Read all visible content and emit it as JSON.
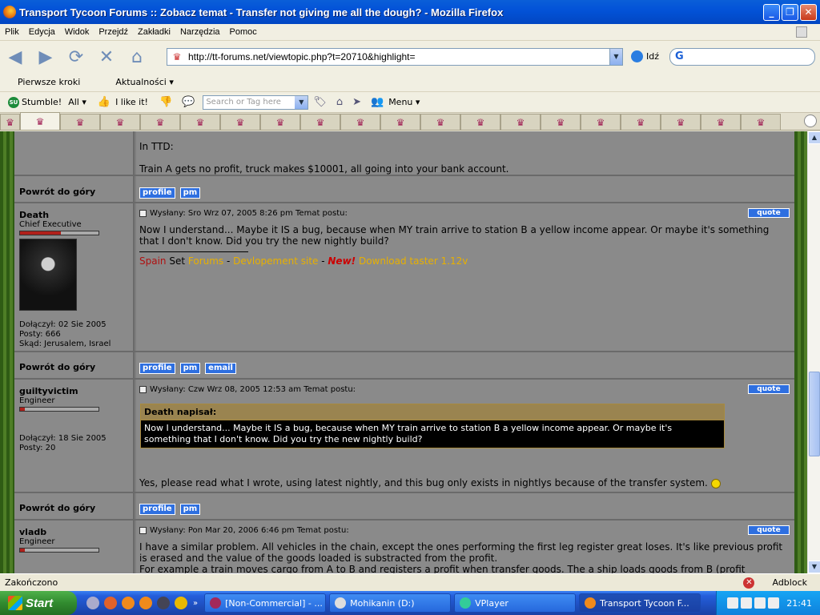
{
  "window": {
    "title": "Transport Tycoon Forums :: Zobacz temat - Transfer not giving me all the dough? - Mozilla Firefox"
  },
  "menu": [
    "Plik",
    "Edycja",
    "Widok",
    "Przejdź",
    "Zakładki",
    "Narzędzia",
    "Pomoc"
  ],
  "nav": {
    "url": "http://tt-forums.net/viewtopic.php?t=20710&highlight=",
    "go_label": "Idź"
  },
  "bookmarks": [
    "Pierwsze kroki",
    "Aktualności"
  ],
  "stumble": {
    "stumble_label": "Stumble!",
    "all_label": "All",
    "like_label": "I like it!",
    "search_placeholder": "Search or Tag here",
    "menu_label": "Menu"
  },
  "forum": {
    "back_label": "Powrót do góry",
    "profile_label": "profile",
    "pm_label": "pm",
    "email_label": "email",
    "quote_label": "quote",
    "post0": {
      "line1": "In TTD:",
      "line2": "Train A gets no profit, truck makes $10001, all going into your bank account."
    },
    "post1": {
      "user": "Death",
      "rank": "Chief Executive",
      "joined": "Dołączył: 02 Sie 2005",
      "posts": "Posty: 666",
      "from": "Skąd: Jerusalem, Israel",
      "head": "Wysłany: Sro Wrz 07, 2005 8:26 pm     Temat postu:",
      "text": "Now I understand... Maybe it IS a bug, because when MY train arrive to station B a yellow income appear. Or maybe it's something that I don't know. Did you try the new nightly build?",
      "sig": {
        "spain": "Spain",
        "set": " Set ",
        "forums": "Forums",
        "dash1": " - ",
        "dev": "Devlopement site",
        "dash2": " - ",
        "new": "New!",
        "dl": " Download taster 1.12v"
      }
    },
    "post2": {
      "user": "guiltyvictim",
      "rank": "Engineer",
      "joined": "Dołączył: 18 Sie 2005",
      "posts": "Posty: 20",
      "head": "Wysłany: Czw Wrz 08, 2005 12:53 am     Temat postu:",
      "quote_head": "Death napisał:",
      "quote_text": "Now I understand... Maybe it IS a bug, because when MY train arrive to station B a yellow income appear. Or maybe it's something that I don't know. Did you try the new nightly build?",
      "text": "Yes, please read what I wrote, using latest nightly, and this bug only exists in nightlys because of the transfer system."
    },
    "post3": {
      "user": "vladb",
      "rank": "Engineer",
      "head": "Wysłany: Pon Mar 20, 2006 6:46 pm     Temat postu:",
      "text": "I have a similar problem. All vehicles in the chain, except the ones performing the first leg register great loses. It's like previous profit is erased and the value of the goods loaded is substracted from the profit.",
      "text2": "For example a train moves cargo from A to B and registers a profit when transfer goods. The a ship loads goods from B (profit"
    }
  },
  "status": {
    "text": "Zakończono",
    "adblock": "Adblock"
  },
  "taskbar": {
    "start": "Start",
    "tasks": [
      "[Non-Commercial] - ...",
      "Mohikanin (D:)",
      "VPlayer",
      "Transport Tycoon F..."
    ],
    "clock": "21:41"
  }
}
